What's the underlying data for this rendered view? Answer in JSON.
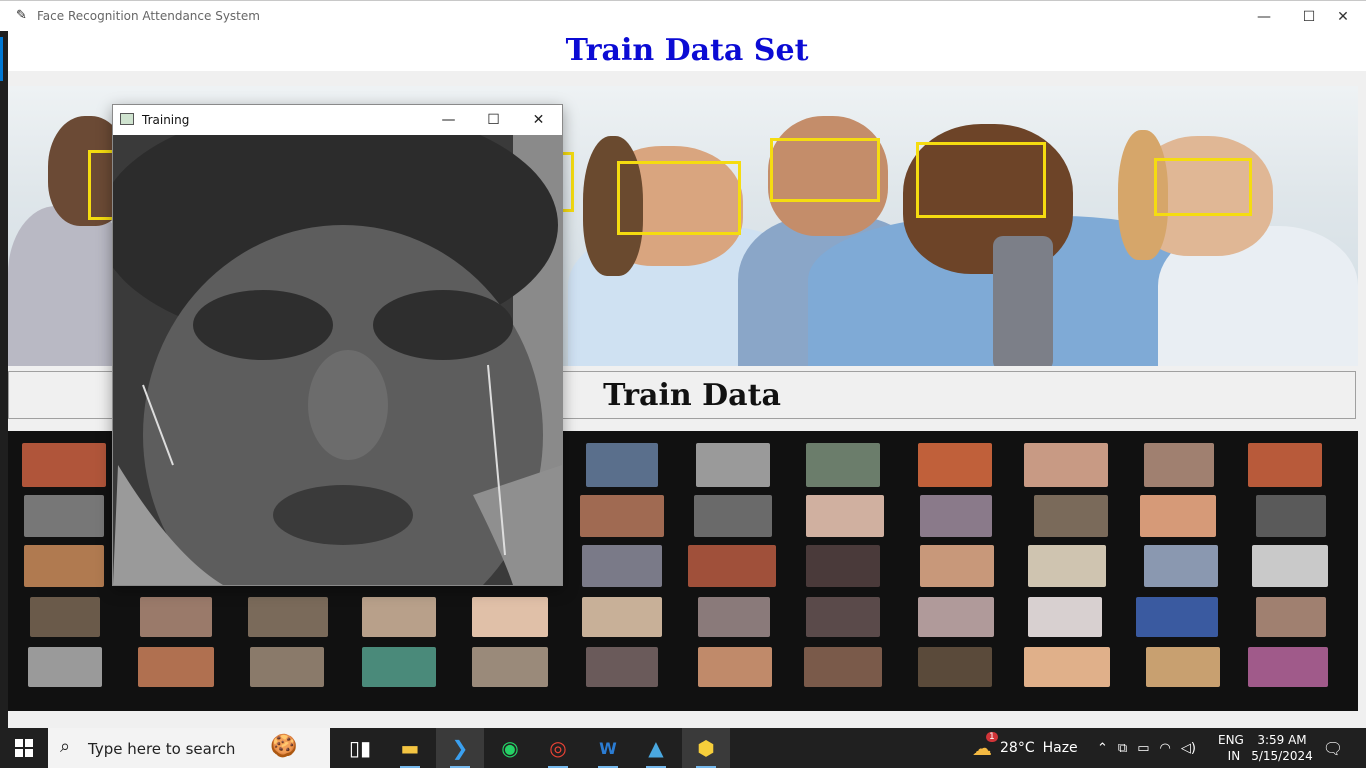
{
  "window": {
    "title": "Face Recognition Attendance System",
    "controls": {
      "minimize": "—",
      "maximize": "☐",
      "close": "✕"
    }
  },
  "page": {
    "heading": "Train Data Set",
    "heading_color": "#0b0bd4",
    "train_button_label": "Train Data"
  },
  "dialog": {
    "title": "Training",
    "controls": {
      "minimize": "—",
      "maximize": "☐",
      "close": "✕"
    }
  },
  "taskbar": {
    "search_placeholder": "Type here to search",
    "pinned_apps": [
      "task-view",
      "file-explorer",
      "vscode",
      "whatsapp",
      "chrome",
      "word",
      "photos",
      "python"
    ],
    "weather": {
      "temp": "28°C",
      "condition": "Haze",
      "badge": "1"
    },
    "language": {
      "lang": "ENG",
      "region": "IN"
    },
    "clock": {
      "time": "3:59 AM",
      "date": "5/15/2024"
    }
  }
}
